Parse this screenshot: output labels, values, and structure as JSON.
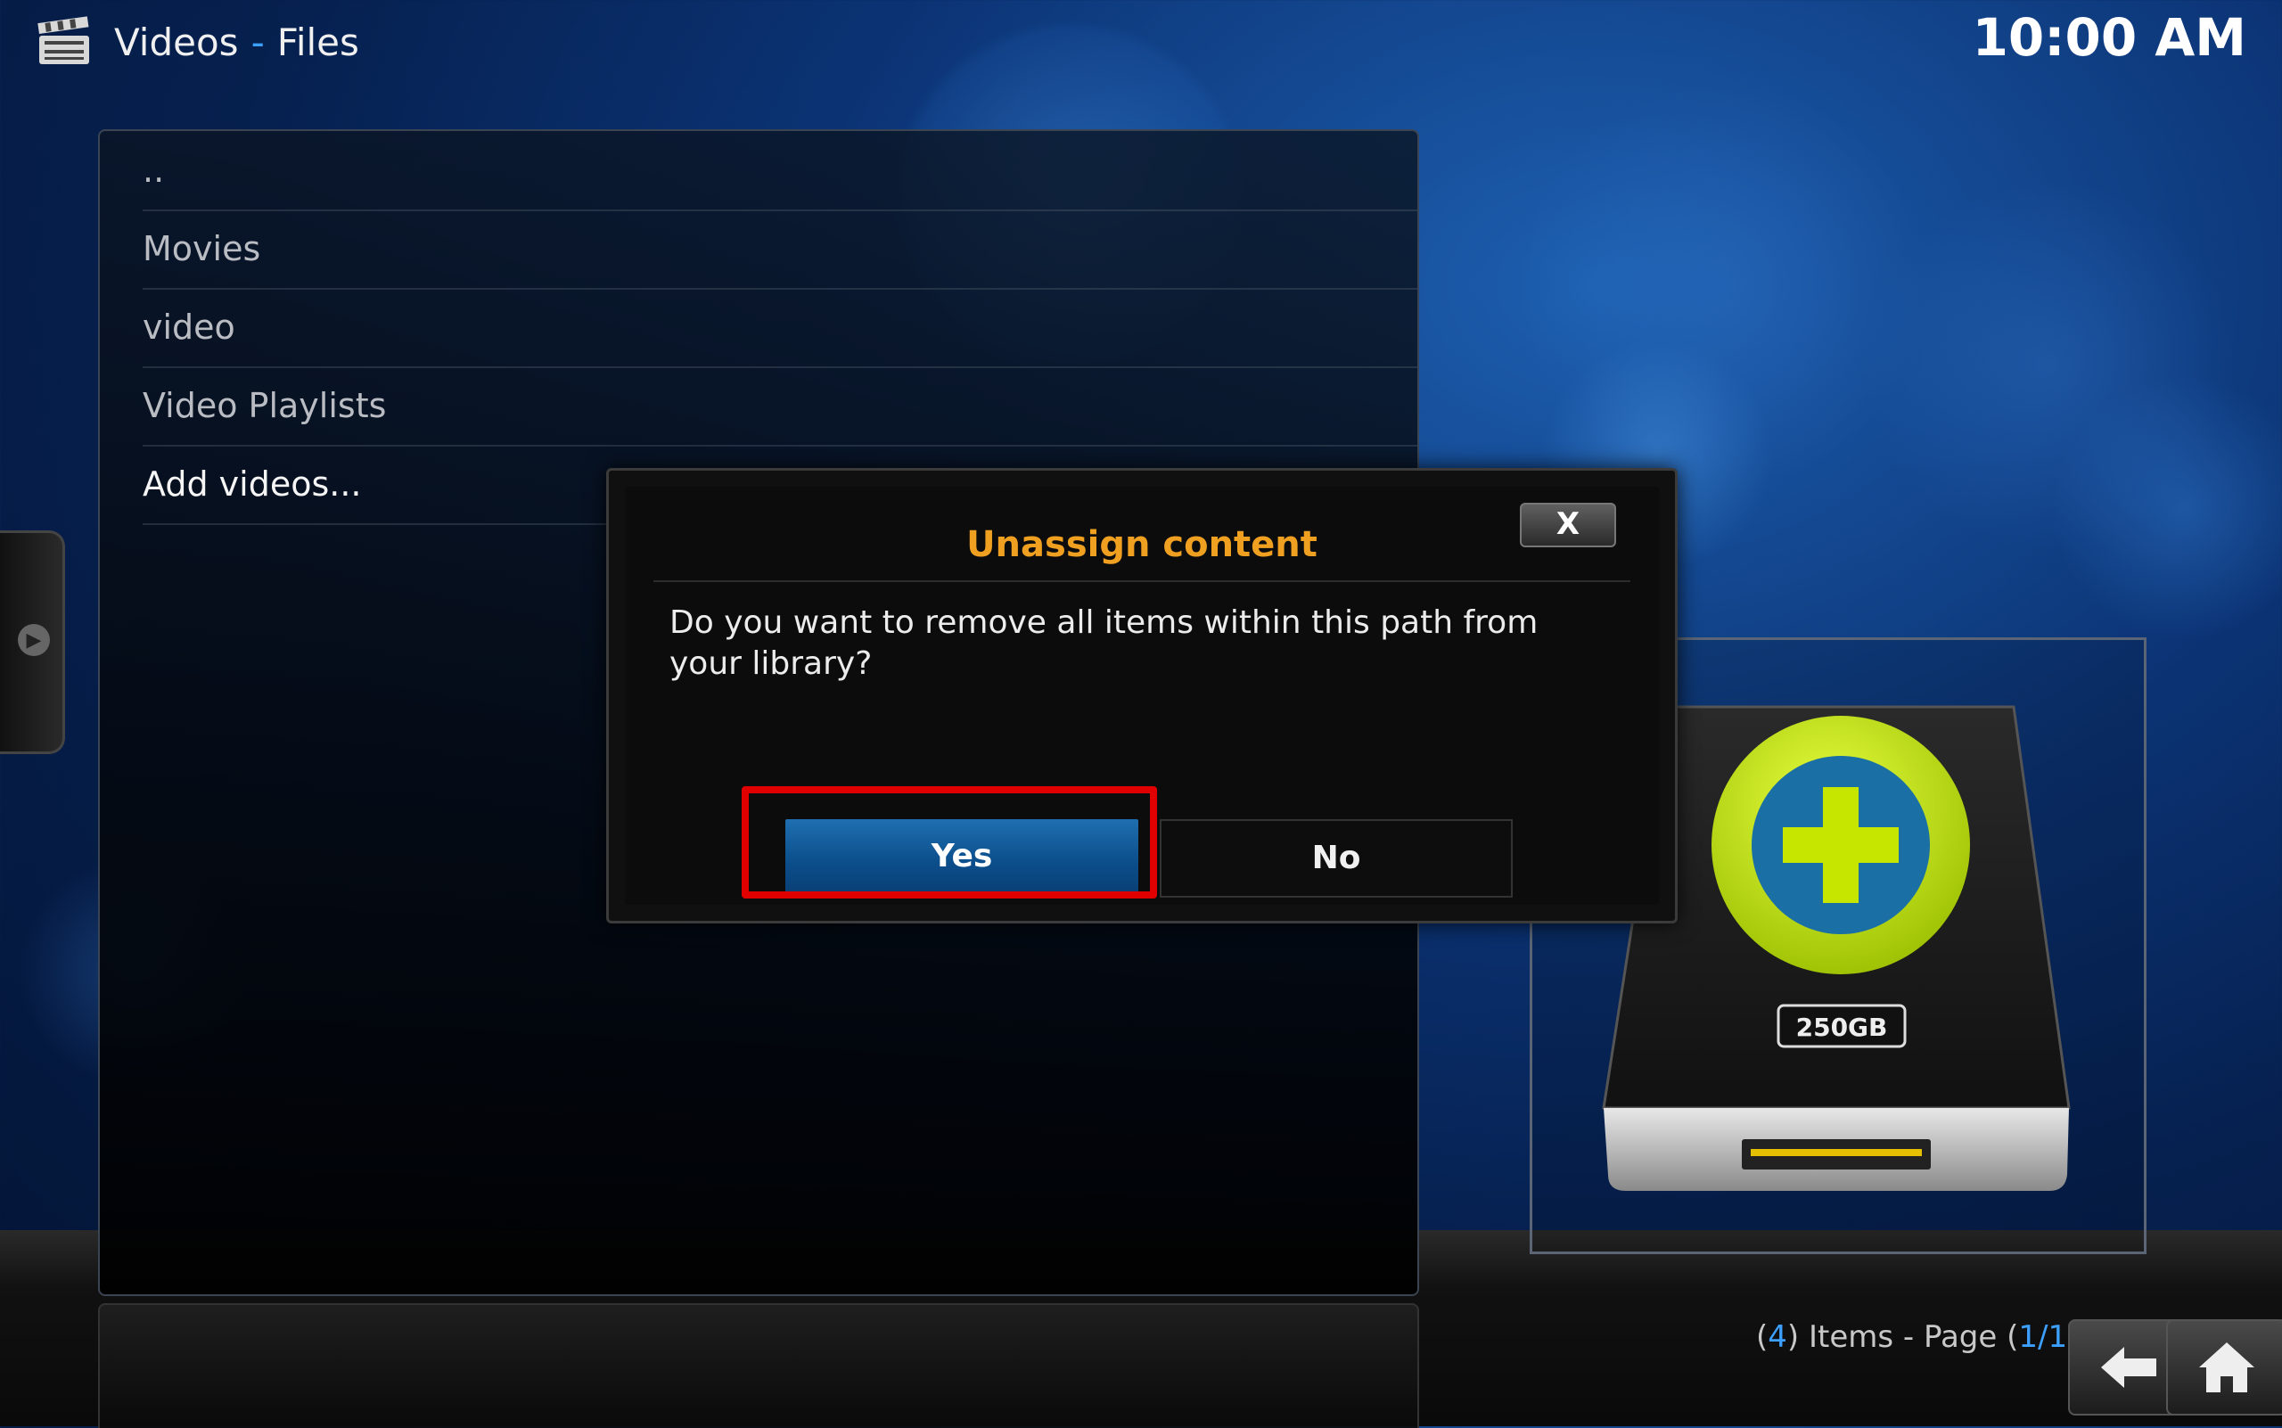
{
  "header": {
    "section": "Videos",
    "separator": "-",
    "subsection": "Files",
    "clock": "10:00 AM"
  },
  "file_list": {
    "items": [
      {
        "label": ".."
      },
      {
        "label": "Movies"
      },
      {
        "label": "video"
      },
      {
        "label": "Video Playlists"
      },
      {
        "label": "Add videos..."
      }
    ]
  },
  "dialog": {
    "title": "Unassign content",
    "close_label": "X",
    "message": "Do you want to remove all items within this path from your library?",
    "yes_label": "Yes",
    "no_label": "No"
  },
  "thumbnail": {
    "capacity_label": "250GB"
  },
  "status": {
    "open1": "(",
    "count": "4",
    "items_text": ") Items - Page (",
    "page": "1/1",
    "close2": ")"
  },
  "colors": {
    "accent_blue": "#3da0ff",
    "title_orange": "#f0a020",
    "highlight_red": "#e00000",
    "plus_green": "#c6e600"
  }
}
